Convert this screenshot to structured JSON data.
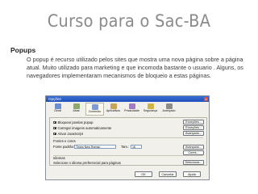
{
  "slide": {
    "title": "Curso para o Sac-BA",
    "heading": "Popups",
    "body": "O popup é recurso utilizado pelos sites que mostra uma nova página sobre a página atual. Muito utilizado para marketing e que incomoda bastante o usuario . Alguns, os navegadores implementaram mecanismos de bloqueio a estas páginas."
  },
  "dialog": {
    "title": "Opções",
    "close_glyph": "x",
    "tabs": [
      {
        "label": "Geral",
        "icon": "gear-icon",
        "color": "#6b8fd1"
      },
      {
        "label": "Abas",
        "icon": "tabs-icon",
        "color": "#8aa96b"
      },
      {
        "label": "Conteúdo",
        "icon": "content-icon",
        "color": "#7e9bd6"
      },
      {
        "label": "Aplicativos",
        "icon": "apps-icon",
        "color": "#c9a456"
      },
      {
        "label": "Privacidade",
        "icon": "privacy-icon",
        "color": "#a07ec0"
      },
      {
        "label": "Segurança",
        "icon": "lock-icon",
        "color": "#d0b343"
      },
      {
        "label": "Avançado",
        "icon": "advanced-icon",
        "color": "#8c8c8c"
      }
    ],
    "active_tab": 2,
    "checks": [
      {
        "label": "Bloquear janelas popup",
        "checked": true
      },
      {
        "label": "Carregar imagens automaticamente",
        "checked": true
      },
      {
        "label": "Ativar JavaScript",
        "checked": true
      }
    ],
    "side_buttons": [
      "Exceções...",
      "Exceções...",
      "Avançado..."
    ],
    "fonts_group": "Fontes e cores",
    "default_font_label": "Fonte padrão:",
    "default_font_value": "Times New Roman",
    "size_label": "Tam.:",
    "size_value": "16",
    "advanced_button": "Avançado...",
    "colors_button": "Cores...",
    "languages_group": "Idiomas",
    "languages_text": "Selecione o idioma preferencial para páginas",
    "select_button": "Selecionar...",
    "footer": {
      "ok": "OK",
      "cancel": "Cancelar",
      "help": "Ajuda"
    },
    "accent": "#1f4fb8"
  }
}
